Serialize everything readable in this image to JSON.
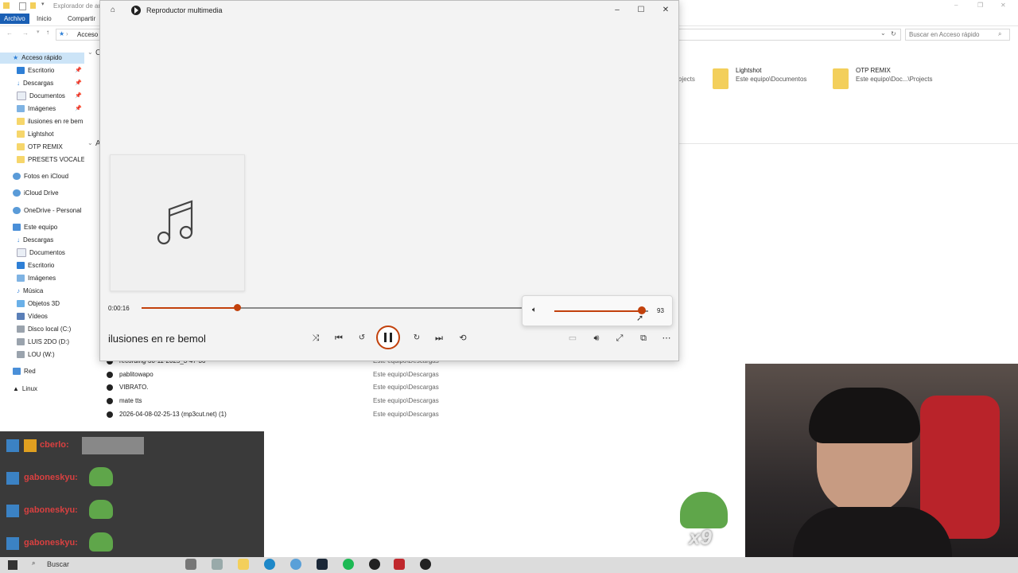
{
  "explorer": {
    "title": "Explorador de ar",
    "ribbon_tabs": [
      "Archivo",
      "Inicio",
      "Compartir"
    ],
    "breadcrumb": "Acceso",
    "search_placeholder": "Buscar en Acceso rápido",
    "nav": {
      "quick_access": "Acceso rápido",
      "items": [
        "Escritorio",
        "Descargas",
        "Documentos",
        "Imágenes",
        "ilusiones en re bem",
        "Lightshot",
        "OTP REMIX",
        "PRESETS VOCALES I"
      ],
      "icloud_photos": "Fotos en iCloud",
      "icloud_drive": "iCloud Drive",
      "onedrive": "OneDrive - Personal",
      "this_pc": "Este equipo",
      "pc_items": [
        "Descargas",
        "Documentos",
        "Escritorio",
        "Imágenes",
        "Música",
        "Objetos 3D",
        "Vídeos",
        "Disco local (C:)",
        "LUIS 2DO (D:)",
        "LOU (W:)"
      ],
      "network": "Red",
      "linux": "Linux"
    },
    "section_letters": [
      "C",
      "A"
    ],
    "quick_folders": [
      {
        "name": "Lightshot",
        "path": "Este equipo\\Documentos"
      },
      {
        "name": "OTP REMIX",
        "path": "Este equipo\\Doc...\\Projects"
      }
    ],
    "partial_text": "ojects",
    "recent_files": [
      {
        "name": "recording-30-11-2025_3-47-36",
        "path": "Este equipo\\Descargas"
      },
      {
        "name": "pablitowapo",
        "path": "Este equipo\\Descargas"
      },
      {
        "name": "VIBRATO.",
        "path": "Este equipo\\Descargas"
      },
      {
        "name": "mate tts",
        "path": "Este equipo\\Descargas"
      },
      {
        "name": "2026-04-08-02-25-13 (mp3cut.net) (1)",
        "path": "Este equipo\\Descargas"
      }
    ]
  },
  "player": {
    "title": "Reproductor multimedia",
    "current_time": "0:00:16",
    "progress": 0.25,
    "track_title": "ilusiones en re bemol",
    "volume": "93",
    "volume_level": 0.93,
    "accent": "#c2410c"
  },
  "chat": {
    "messages": [
      {
        "user": "cberlo:"
      },
      {
        "user": "gaboneskyu:"
      },
      {
        "user": "gaboneskyu:"
      },
      {
        "user": "gaboneskyu:"
      }
    ],
    "combo": "x9"
  },
  "taskbar": {
    "search_label": "Buscar"
  }
}
